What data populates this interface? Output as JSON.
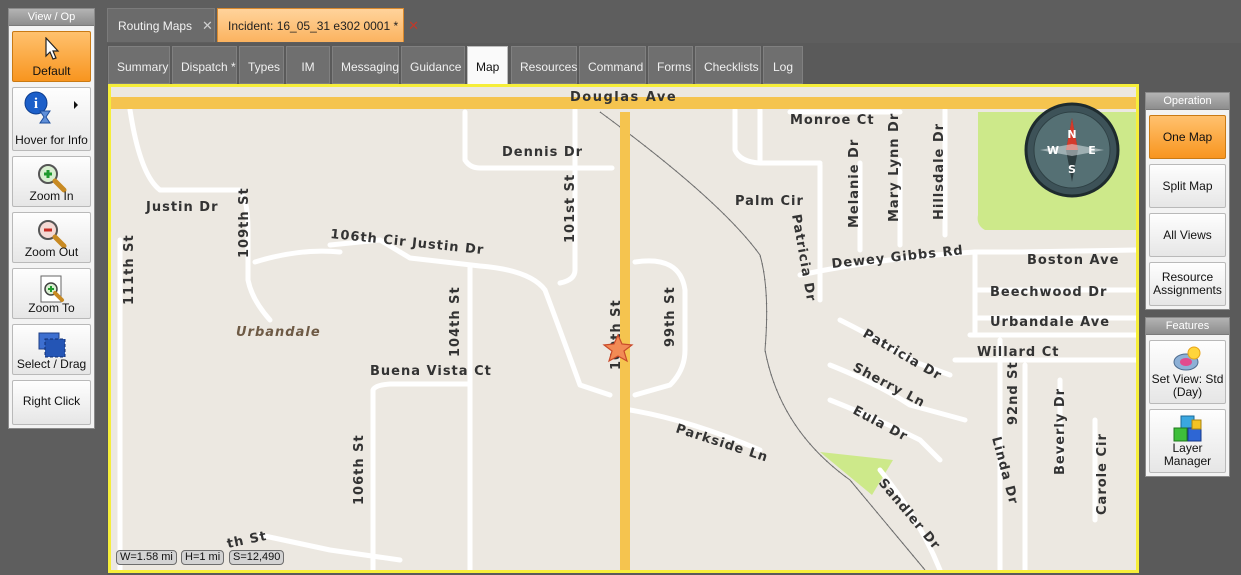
{
  "left_panel": {
    "title": "View / Op",
    "tools": [
      {
        "label": "Default",
        "icon": "cursor-arrow-icon"
      },
      {
        "label": "Hover for Info",
        "icon": "info-hover-icon"
      },
      {
        "label": "Zoom In",
        "icon": "zoom-in-icon"
      },
      {
        "label": "Zoom Out",
        "icon": "zoom-out-icon"
      },
      {
        "label": "Zoom To",
        "icon": "zoom-to-icon"
      },
      {
        "label": "Select / Drag",
        "icon": "select-drag-icon"
      },
      {
        "label": "Right Click",
        "icon": ""
      }
    ],
    "active_tool": "Default"
  },
  "doc_tabs": [
    {
      "label": "Routing Maps",
      "active": false
    },
    {
      "label": "Incident: 16_05_31 e302 0001 *",
      "active": true
    }
  ],
  "sub_tabs": [
    "Summary",
    "Dispatch *",
    "Types",
    "IM",
    "Messaging",
    "Guidance",
    "Map",
    "Resources",
    "Command",
    "Forms",
    "Checklists",
    "Log"
  ],
  "active_sub_tab": "Map",
  "map": {
    "streets": {
      "douglas_ave": "Douglas Ave",
      "monroe_ct": "Monroe Ct",
      "dennis_dr": "Dennis Dr",
      "justin_dr_w": "Justin Dr",
      "justin_dr": "106th Cir Justin Dr",
      "st_109": "109th St",
      "st_111": "111th St",
      "st_101": "101st St",
      "st_100": "100th St",
      "st_99": "99th St",
      "st_104": "104th St",
      "st_106": "106th St",
      "st_bottom": "th St",
      "palm_cir": "Palm Cir",
      "patricia_dr_v": "Patricia Dr",
      "melanie_dr": "Melanie Dr",
      "mary_lynn_dr": "Mary Lynn Dr",
      "hillsdale_dr": "Hillsdale Dr",
      "dewey_gibbs_rd": "Dewey Gibbs Rd",
      "boston_ave": "Boston Ave",
      "beechwood_dr": "Beechwood Dr",
      "urbandale_ave": "Urbandale Ave",
      "willard_ct": "Willard Ct",
      "patricia_dr": "Patricia Dr",
      "sherry_ln": "Sherry Ln",
      "eula_dr": "Eula Dr",
      "nd_92": "92nd St",
      "linda_dr": "Linda Dr",
      "beverly_dr": "Beverly Dr",
      "carole_cir": "Carole Cir",
      "parkside_ln": "Parkside Ln",
      "sandler_dr": "Sandler Dr",
      "buena_vista_ct": "Buena Vista Ct"
    },
    "area_label": "Urbandale",
    "compass": [
      "N",
      "E",
      "S",
      "W"
    ],
    "scale": {
      "width": "W=1.58 mi",
      "height": "H=1 mi",
      "scale": "S=12,490"
    },
    "colors": {
      "background": "#ece8e1",
      "major_road": "#f5c44f",
      "park": "#cde98a",
      "border": "#f6ee3a"
    }
  },
  "operation_panel": {
    "title": "Operation",
    "buttons": [
      "One Map",
      "Split Map",
      "All Views",
      "Resource Assignments"
    ],
    "active": "One Map"
  },
  "features_panel": {
    "title": "Features",
    "buttons": [
      {
        "label": "Set View: Std (Day)",
        "icon": "set-view-icon"
      },
      {
        "label": "Layer Manager",
        "icon": "layer-cubes-icon"
      }
    ]
  }
}
